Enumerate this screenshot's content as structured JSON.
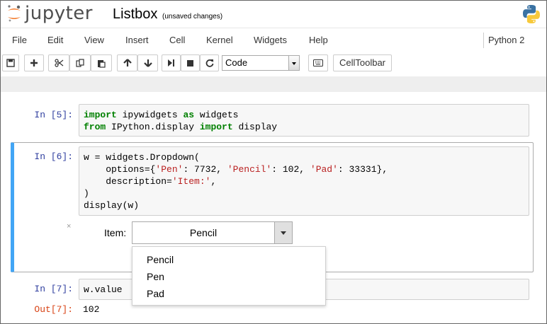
{
  "header": {
    "brand": "jupyter",
    "notebook_name": "Listbox",
    "save_status": "(unsaved changes)"
  },
  "menubar": {
    "items": [
      "File",
      "Edit",
      "View",
      "Insert",
      "Cell",
      "Kernel",
      "Widgets",
      "Help"
    ],
    "kernel": "Python 2"
  },
  "toolbar": {
    "cell_type": "Code",
    "cell_toolbar_label": "CellToolbar",
    "icons": [
      "save-icon",
      "add-icon",
      "cut-icon",
      "copy-icon",
      "paste-icon",
      "move-up-icon",
      "move-down-icon",
      "run-icon",
      "stop-icon",
      "restart-icon",
      "keyboard-icon"
    ]
  },
  "cells": [
    {
      "prompt": "In [5]:",
      "lines": [
        [
          {
            "t": "import",
            "c": "kw"
          },
          {
            "t": " ipywidgets "
          },
          {
            "t": "as",
            "c": "kw"
          },
          {
            "t": " widgets"
          }
        ],
        [
          {
            "t": "from",
            "c": "kw"
          },
          {
            "t": " IPython.display "
          },
          {
            "t": "import",
            "c": "kw"
          },
          {
            "t": " display"
          }
        ]
      ]
    },
    {
      "prompt": "In [6]:",
      "lines": [
        [
          {
            "t": "w = widgets.Dropdown("
          }
        ],
        [
          {
            "t": "    options={"
          },
          {
            "t": "'Pen'",
            "c": "st"
          },
          {
            "t": ": 7732, "
          },
          {
            "t": "'Pencil'",
            "c": "st"
          },
          {
            "t": ": 102, "
          },
          {
            "t": "'Pad'",
            "c": "st"
          },
          {
            "t": ": 33331},"
          }
        ],
        [
          {
            "t": "    description="
          },
          {
            "t": "'Item:'",
            "c": "st"
          },
          {
            "t": ","
          }
        ],
        [
          {
            "t": ")"
          }
        ],
        [
          {
            "t": "display(w)"
          }
        ]
      ]
    },
    {
      "prompt": "In [7]:",
      "lines": [
        [
          {
            "t": "w.value"
          }
        ]
      ]
    }
  ],
  "widget": {
    "close_glyph": "×",
    "label": "Item:",
    "selected": "Pencil",
    "options": [
      "Pencil",
      "Pen",
      "Pad"
    ]
  },
  "output": {
    "prompt": "Out[7]:",
    "value": "102"
  }
}
